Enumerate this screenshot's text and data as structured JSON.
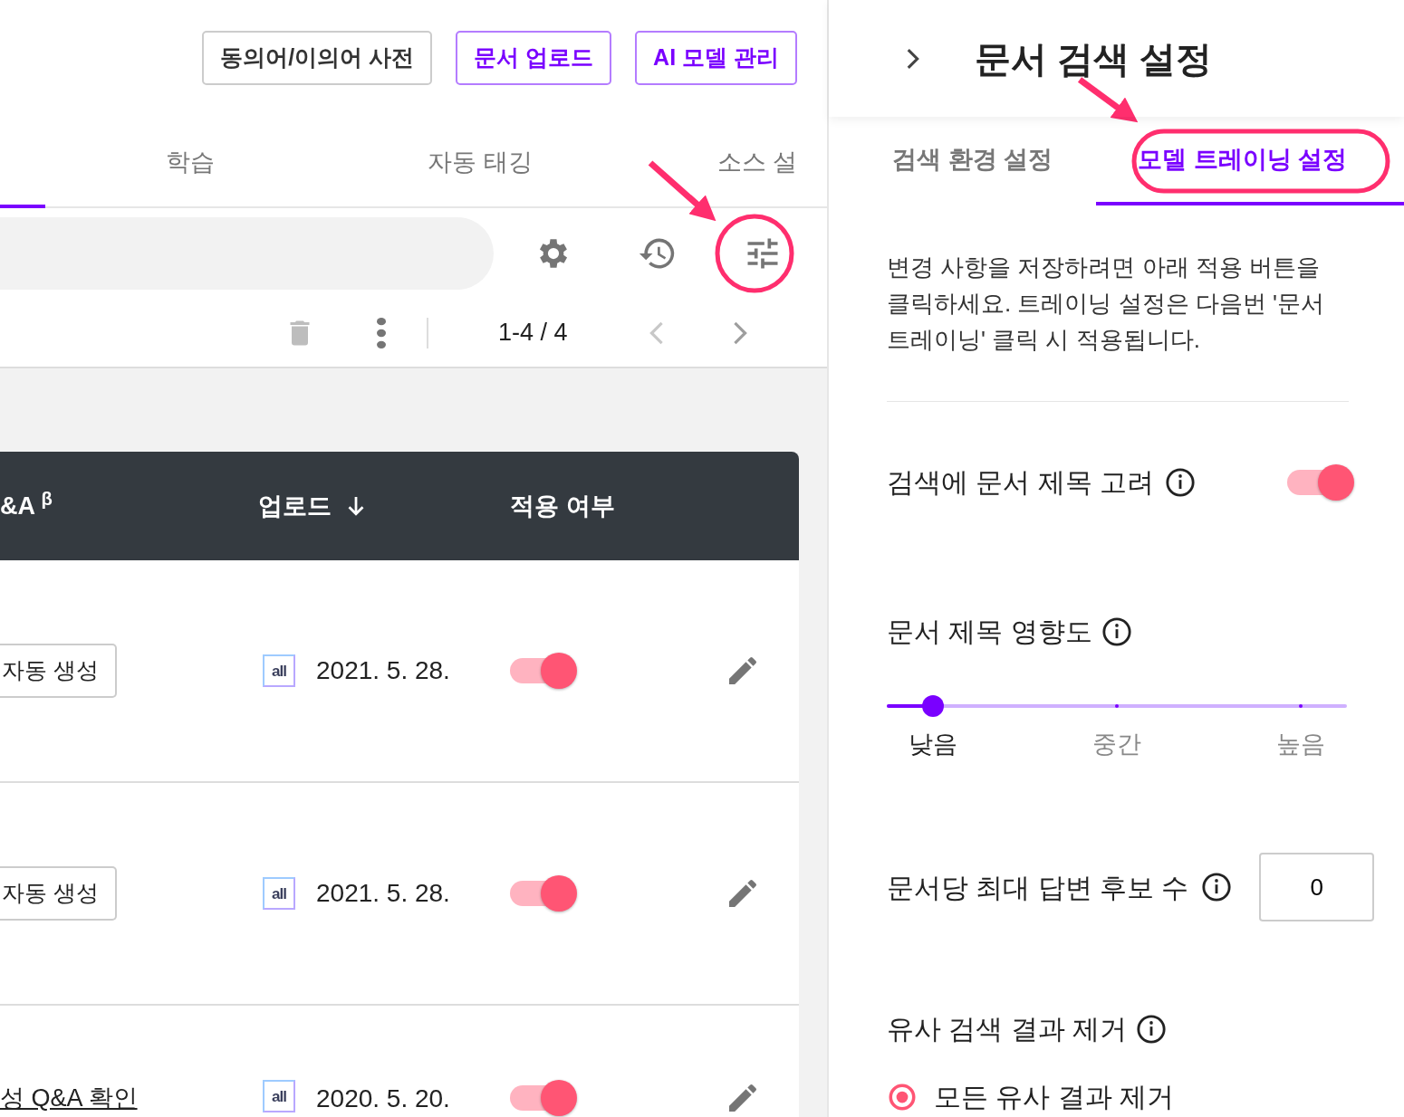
{
  "top_buttons": [
    {
      "label": "동의어/이의어 사전",
      "kind": "outline"
    },
    {
      "label": "문서 업로드",
      "kind": "accent"
    },
    {
      "label": "AI 모델 관리",
      "kind": "accent"
    }
  ],
  "tabs": [
    {
      "label": "학습",
      "selected": false
    },
    {
      "label": "자동 태깅",
      "selected": false
    },
    {
      "label": "소스 설",
      "selected": false
    }
  ],
  "pagination": "1-4 / 4",
  "table": {
    "columns": [
      {
        "label": "&A $^{β}$",
        "sorted": false
      },
      {
        "label": "업로드",
        "sorted": true
      },
      {
        "label": "적용 여부",
        "sorted": false
      }
    ],
    "rows": [
      {
        "action": "자동 생성",
        "kind": "button",
        "source": "all",
        "date": "2021. 5. 28.",
        "applied": true
      },
      {
        "action": "자동 생성",
        "kind": "button",
        "source": "all",
        "date": "2021. 5. 28.",
        "applied": true
      },
      {
        "action": "성 Q&A 확인",
        "kind": "link",
        "source": "all",
        "date": "2020. 5. 20.",
        "applied": true
      }
    ]
  },
  "panel": {
    "title": "문서 검색 설정",
    "tabs": [
      {
        "label": "검색 환경 설정",
        "selected": false
      },
      {
        "label": "모델 트레이닝 설정",
        "selected": true
      }
    ],
    "notice": "변경 사항을 저장하려면 아래 적용 버튼을 클릭하세요. 트레이닝 설정은 다음번 '문서 트레이닝' 클릭 시 적용됩니다.",
    "settings": [
      {
        "kind": "switch",
        "label": "검색에 문서 제목 고려",
        "on": true
      },
      {
        "kind": "slider",
        "label": "문서 제목 영향도",
        "level": 0.1,
        "steps": [
          {
            "label": "낮음",
            "selected": true
          },
          {
            "label": "중간",
            "selected": false
          },
          {
            "label": "높음",
            "selected": false
          }
        ]
      },
      {
        "kind": "number",
        "label": "문서당 최대 답변 후보 수",
        "value": "0"
      },
      {
        "kind": "radio",
        "label": "유사 검색 결과 제거",
        "options": [
          {
            "label": "모든 유사 결과 제거",
            "selected": true
          }
        ]
      }
    ]
  }
}
